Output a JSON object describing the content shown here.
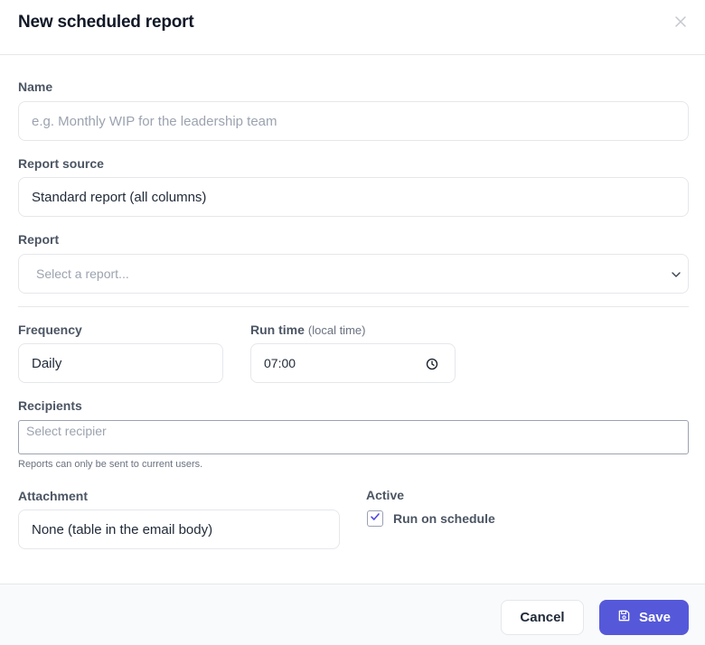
{
  "dialog": {
    "title": "New scheduled report"
  },
  "form": {
    "name": {
      "label": "Name",
      "placeholder": "e.g. Monthly WIP for the leadership team",
      "value": ""
    },
    "report_source": {
      "label": "Report source",
      "value": "Standard report (all columns)"
    },
    "report": {
      "label": "Report",
      "placeholder": "Select a report..."
    },
    "frequency": {
      "label": "Frequency",
      "value": "Daily"
    },
    "run_time": {
      "label": "Run time",
      "hint": "(local time)",
      "value": "07:00"
    },
    "recipients": {
      "label": "Recipients",
      "placeholder": "Select recipier",
      "helper": "Reports can only be sent to current users."
    },
    "attachment": {
      "label": "Attachment",
      "value": "None (table in the email body)"
    },
    "active": {
      "label": "Active",
      "checkbox_label": "Run on schedule",
      "checked": true
    }
  },
  "footer": {
    "cancel_label": "Cancel",
    "save_label": "Save"
  },
  "icons": {
    "close": "close-icon",
    "chevron": "chevron-down-icon",
    "clock": "clock-icon",
    "check": "check-icon",
    "save": "floppy-disk-icon"
  },
  "colors": {
    "primary": "#5558d9",
    "checkmark": "#4f46e5"
  }
}
